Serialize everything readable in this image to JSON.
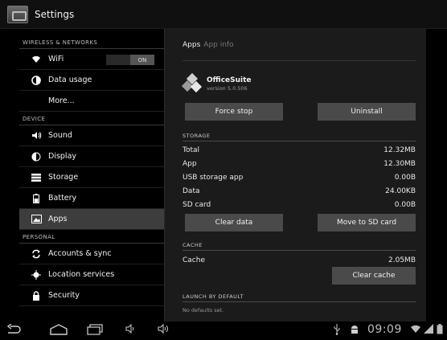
{
  "actionbar": {
    "title": "Settings"
  },
  "sidebar": {
    "sections": [
      {
        "header": "WIRELESS & NETWORKS"
      },
      {
        "header": "DEVICE"
      },
      {
        "header": "PERSONAL"
      }
    ],
    "items": [
      {
        "label": "WiFi",
        "icon": "wifi-icon"
      },
      {
        "label": "Data usage",
        "icon": "data-usage-icon"
      },
      {
        "label": "More..."
      },
      {
        "label": "Sound",
        "icon": "speaker-icon"
      },
      {
        "label": "Display",
        "icon": "brightness-icon"
      },
      {
        "label": "Storage",
        "icon": "storage-icon"
      },
      {
        "label": "Battery",
        "icon": "battery-icon"
      },
      {
        "label": "Apps",
        "icon": "apps-icon",
        "selected": true
      },
      {
        "label": "Accounts & sync",
        "icon": "sync-icon"
      },
      {
        "label": "Location services",
        "icon": "location-icon"
      },
      {
        "label": "Security",
        "icon": "lock-icon"
      }
    ],
    "wifi_toggle": "ON"
  },
  "detail": {
    "tabs": [
      "Apps",
      "App info"
    ],
    "app_name": "OfficeSuite",
    "app_version": "version 5.0.506",
    "force_stop": "Force stop",
    "uninstall": "Uninstall",
    "storage_header": "STORAGE",
    "storage_rows": [
      {
        "label": "Total",
        "value": "12.32MB"
      },
      {
        "label": "App",
        "value": "12.30MB"
      },
      {
        "label": "USB storage app",
        "value": "0.00B"
      },
      {
        "label": "Data",
        "value": "24.00KB"
      },
      {
        "label": "SD card",
        "value": "0.00B"
      }
    ],
    "clear_data": "Clear data",
    "move_to_sd": "Move to SD card",
    "cache_header": "CACHE",
    "cache_label": "Cache",
    "cache_value": "2.05MB",
    "clear_cache": "Clear cache",
    "launch_header": "LAUNCH BY DEFAULT",
    "no_defaults": "No defaults set."
  },
  "statusbar": {
    "clock": "09:09"
  }
}
